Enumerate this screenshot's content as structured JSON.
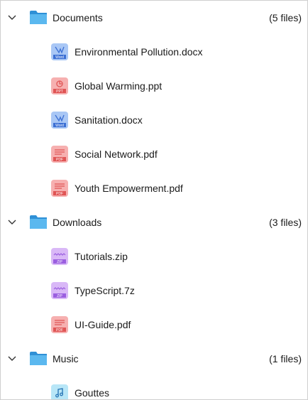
{
  "colors": {
    "word": "#3b6fd4",
    "word_bg": "#a9c7f5",
    "ppt": "#e05555",
    "ppt_bg": "#f6b0b0",
    "pdf": "#e05555",
    "pdf_bg": "#f6b0b0",
    "zip": "#9b5fe0",
    "zip_bg": "#d9b8f7",
    "audio": "#1f6fb2",
    "audio_bg": "#b8e6f7",
    "folder": "#5bb8ef",
    "folder_tab": "#2f90d6"
  },
  "tree": [
    {
      "name": "Documents",
      "count": "(5 files)",
      "files": [
        {
          "name": "Environmental Pollution.docx",
          "icon": "word-icon",
          "badge": "Word"
        },
        {
          "name": "Global Warming.ppt",
          "icon": "ppt-icon",
          "badge": "PPT"
        },
        {
          "name": "Sanitation.docx",
          "icon": "word-icon",
          "badge": "Word"
        },
        {
          "name": "Social Network.pdf",
          "icon": "pdf-icon",
          "badge": "PDF"
        },
        {
          "name": "Youth Empowerment.pdf",
          "icon": "pdf-icon",
          "badge": "PDF"
        }
      ]
    },
    {
      "name": "Downloads",
      "count": "(3 files)",
      "files": [
        {
          "name": "Tutorials.zip",
          "icon": "zip-icon",
          "badge": "ZIP"
        },
        {
          "name": "TypeScript.7z",
          "icon": "zip-icon",
          "badge": "ZIP"
        },
        {
          "name": "UI-Guide.pdf",
          "icon": "pdf-icon",
          "badge": "PDF"
        }
      ]
    },
    {
      "name": "Music",
      "count": "(1 files)",
      "files": [
        {
          "name": "Gouttes",
          "icon": "audio-icon",
          "badge": ""
        }
      ]
    }
  ]
}
